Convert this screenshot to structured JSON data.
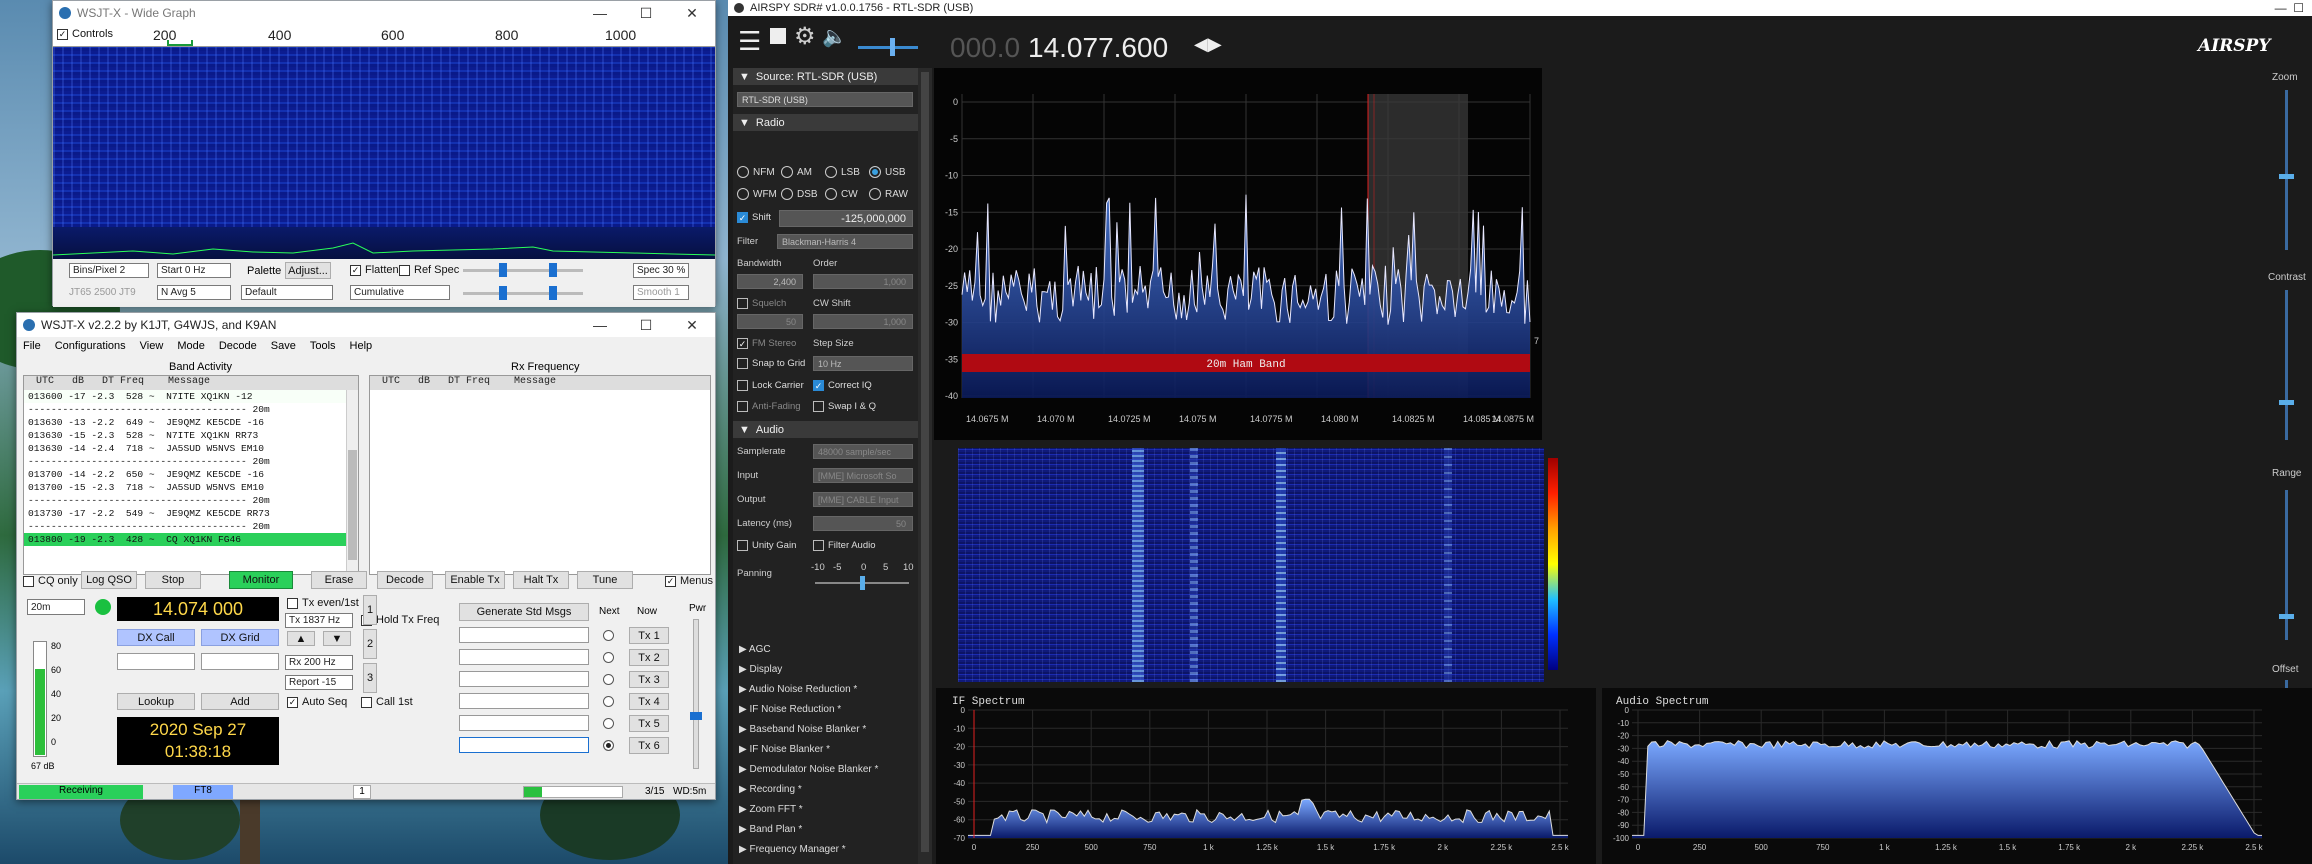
{
  "wide_graph": {
    "title": "WSJT-X - Wide Graph",
    "controls_label": "Controls",
    "scale": [
      "200",
      "400",
      "600",
      "800",
      "1000"
    ],
    "bins_pixel": "Bins/Pixel 2",
    "start": "Start 0 Hz",
    "palette_label": "Palette",
    "adjust_label": "Adjust...",
    "flatten_label": "Flatten",
    "ref_spec_label": "Ref Spec",
    "spec_pct": "Spec 30 %",
    "mode_text": "JT65  2500  JT9",
    "n_avg": "N Avg 5",
    "palette_value": "Default",
    "cumulative_value": "Cumulative",
    "smooth": "Smooth 1"
  },
  "wsjt": {
    "title": "WSJT-X   v2.2.2   by K1JT, G4WJS, and K9AN",
    "menu": [
      "File",
      "Configurations",
      "View",
      "Mode",
      "Decode",
      "Save",
      "Tools",
      "Help"
    ],
    "band_activity_label": "Band Activity",
    "rx_frequency_label": "Rx Frequency",
    "col_header": "UTC   dB   DT Freq    Message",
    "decodes": [
      {
        "text": "013600 -17 -2.3  528 ~  N7ITE XQ1KN -12",
        "kind": "hl"
      },
      {
        "text": "-------------------------------------- 20m",
        "kind": "sep"
      },
      {
        "text": "013630 -13 -2.2  649 ~  JE9QMZ KE5CDE -16",
        "kind": "n"
      },
      {
        "text": "013630 -15 -2.3  528 ~  N7ITE XQ1KN RR73",
        "kind": "n"
      },
      {
        "text": "013630 -14 -2.4  718 ~  JA5SUD W5NVS EM10",
        "kind": "n"
      },
      {
        "text": "-------------------------------------- 20m",
        "kind": "sep"
      },
      {
        "text": "013700 -14 -2.2  650 ~  JE9QMZ KE5CDE -16",
        "kind": "n"
      },
      {
        "text": "013700 -15 -2.3  718 ~  JA5SUD W5NVS EM10",
        "kind": "n"
      },
      {
        "text": "-------------------------------------- 20m",
        "kind": "sep"
      },
      {
        "text": "013730 -17 -2.2  549 ~  JE9QMZ KE5CDE RR73",
        "kind": "n"
      },
      {
        "text": "-------------------------------------- 20m",
        "kind": "sep"
      },
      {
        "text": "013800 -19 -2.3  428 ~  CQ XQ1KN FG46",
        "kind": "cq"
      }
    ],
    "cq_only_label": "CQ only",
    "log_qso_label": "Log QSO",
    "stop_label": "Stop",
    "monitor_label": "Monitor",
    "erase_label": "Erase",
    "decode_label": "Decode",
    "enable_tx_label": "Enable Tx",
    "halt_tx_label": "Halt Tx",
    "tune_label": "Tune",
    "menus_label": "Menus",
    "band": "20m",
    "frequency": "14.074 000",
    "tx_even_label": "Tx even/1st",
    "tx_hz": "Tx  1837  Hz",
    "hold_tx_label": "Hold Tx Freq",
    "rx_hz": "Rx  200  Hz",
    "report": "Report -15",
    "auto_seq_label": "Auto Seq",
    "call_1st_label": "Call 1st",
    "dx_call_label": "DX Call",
    "dx_grid_label": "DX Grid",
    "lookup_label": "Lookup",
    "add_label": "Add",
    "date": "2020 Sep 27",
    "time": "01:38:18",
    "meter_scale": [
      "80",
      "60",
      "40",
      "20",
      "0"
    ],
    "meter_db": "67 dB",
    "gen_msgs_label": "Generate Std Msgs",
    "next_label": "Next",
    "now_label": "Now",
    "tx_buttons": [
      "Tx 1",
      "Tx 2",
      "Tx 3",
      "Tx 4",
      "Tx 5",
      "Tx 6"
    ],
    "pwr_label": "Pwr",
    "tab_labels": [
      "1",
      "2",
      "3"
    ],
    "status_receiving": "Receiving",
    "status_mode": "FT8",
    "status_num": "1",
    "status_count": "3/15",
    "status_wd": "WD:5m"
  },
  "sdr": {
    "title": "AIRSPY SDR# v1.0.0.1756 - RTL-SDR (USB)",
    "freq_dim": "000.0",
    "freq_main": "14.077.600",
    "logo": "AIRSPY",
    "zoom_label": "Zoom",
    "contrast_label": "Contrast",
    "range_label": "Range",
    "offset_label": "Offset",
    "source_header": "Source: RTL-SDR (USB)",
    "source_value": "RTL-SDR (USB)",
    "radio_header": "Radio",
    "modes_row1": [
      "NFM",
      "AM",
      "LSB",
      "USB"
    ],
    "modes_row2": [
      "WFM",
      "DSB",
      "CW",
      "RAW"
    ],
    "selected_mode": "USB",
    "shift_label": "Shift",
    "shift_value": "-125,000,000",
    "filter_label": "Filter",
    "filter_value": "Blackman-Harris 4",
    "bandwidth_label": "Bandwidth",
    "order_label": "Order",
    "bandwidth_value": "2,400",
    "order_value": "1,000",
    "squelch_label": "Squelch",
    "cw_shift_label": "CW Shift",
    "squelch_value": "50",
    "cw_shift_value": "1,000",
    "fm_stereo_label": "FM Stereo",
    "step_size_label": "Step Size",
    "snap_label": "Snap to Grid",
    "step_value": "10 Hz",
    "lock_carrier_label": "Lock Carrier",
    "correct_iq_label": "Correct IQ",
    "anti_fading_label": "Anti-Fading",
    "swap_iq_label": "Swap I & Q",
    "audio_header": "Audio",
    "samplerate_label": "Samplerate",
    "samplerate_value": "48000 sample/sec",
    "input_label": "Input",
    "input_value": "[MME] Microsoft So",
    "output_label": "Output",
    "output_value": "[MME] CABLE Input",
    "latency_label": "Latency (ms)",
    "latency_value": "50",
    "unity_gain_label": "Unity Gain",
    "filter_audio_label": "Filter Audio",
    "panning_label": "Panning",
    "panning_scale": [
      "-10",
      "-5",
      "0",
      "5",
      "10"
    ],
    "collapsed_sections": [
      "AGC",
      "Display",
      "Audio Noise Reduction *",
      "IF Noise Reduction *",
      "Baseband Noise Blanker *",
      "IF Noise Blanker *",
      "Demodulator Noise Blanker *",
      "Recording *",
      "Zoom FFT *",
      "Band Plan *",
      "Frequency Manager *"
    ],
    "spectrum_db_ticks": [
      "0",
      "-5",
      "-10",
      "-15",
      "-20",
      "-25",
      "-30",
      "-35",
      "-40"
    ],
    "spectrum_freq_ticks": [
      "14.0675 M",
      "14.070 M",
      "14.0725 M",
      "14.075 M",
      "14.0775 M",
      "14.080 M",
      "14.0825 M",
      "14.085 M",
      "14.0875 M"
    ],
    "band_label": "20m Ham Band",
    "range_marker": "7",
    "if_spectrum_label": "IF Spectrum",
    "audio_spectrum_label": "Audio Spectrum",
    "if_db_ticks": [
      "0",
      "-10",
      "-20",
      "-30",
      "-40",
      "-50",
      "-60",
      "-70"
    ],
    "audio_db_ticks": [
      "0",
      "-10",
      "-20",
      "-30",
      "-40",
      "-50",
      "-60",
      "-70",
      "-80",
      "-90",
      "-100"
    ],
    "hz_ticks": [
      "0",
      "250",
      "500",
      "750",
      "1 k",
      "1.25 k",
      "1.5 k",
      "1.75 k",
      "2 k",
      "2.25 k",
      "2.5 k"
    ]
  }
}
